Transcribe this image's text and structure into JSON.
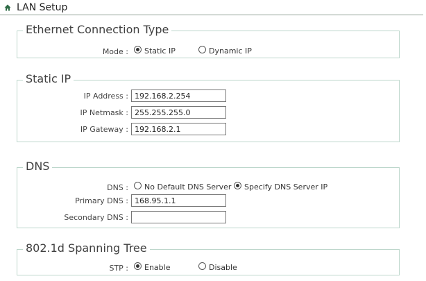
{
  "header": {
    "title": "LAN Setup",
    "icon": "home-icon"
  },
  "ethernet": {
    "legend": "Ethernet Connection Type",
    "mode_label": "Mode :",
    "options": [
      "Static IP",
      "Dynamic IP"
    ],
    "selected": "Static IP"
  },
  "static_ip": {
    "legend": "Static IP",
    "ip_address_label": "IP Address :",
    "ip_address": "192.168.2.254",
    "ip_netmask_label": "IP Netmask :",
    "ip_netmask": "255.255.255.0",
    "ip_gateway_label": "IP Gateway :",
    "ip_gateway": "192.168.2.1"
  },
  "dns": {
    "legend": "DNS",
    "dns_label": "DNS :",
    "options": [
      "No Default DNS Server",
      "Specify DNS Server IP"
    ],
    "selected": "Specify DNS Server IP",
    "primary_label": "Primary DNS :",
    "primary": "168.95.1.1",
    "secondary_label": "Secondary DNS :",
    "secondary": ""
  },
  "stp": {
    "legend": "802.1d Spanning Tree",
    "stp_label": "STP :",
    "options": [
      "Enable",
      "Disable"
    ],
    "selected": "Enable"
  },
  "colors": {
    "border": "#bcd6cb",
    "header_line": "#8fa095",
    "home_icon": "#2e6b45"
  }
}
